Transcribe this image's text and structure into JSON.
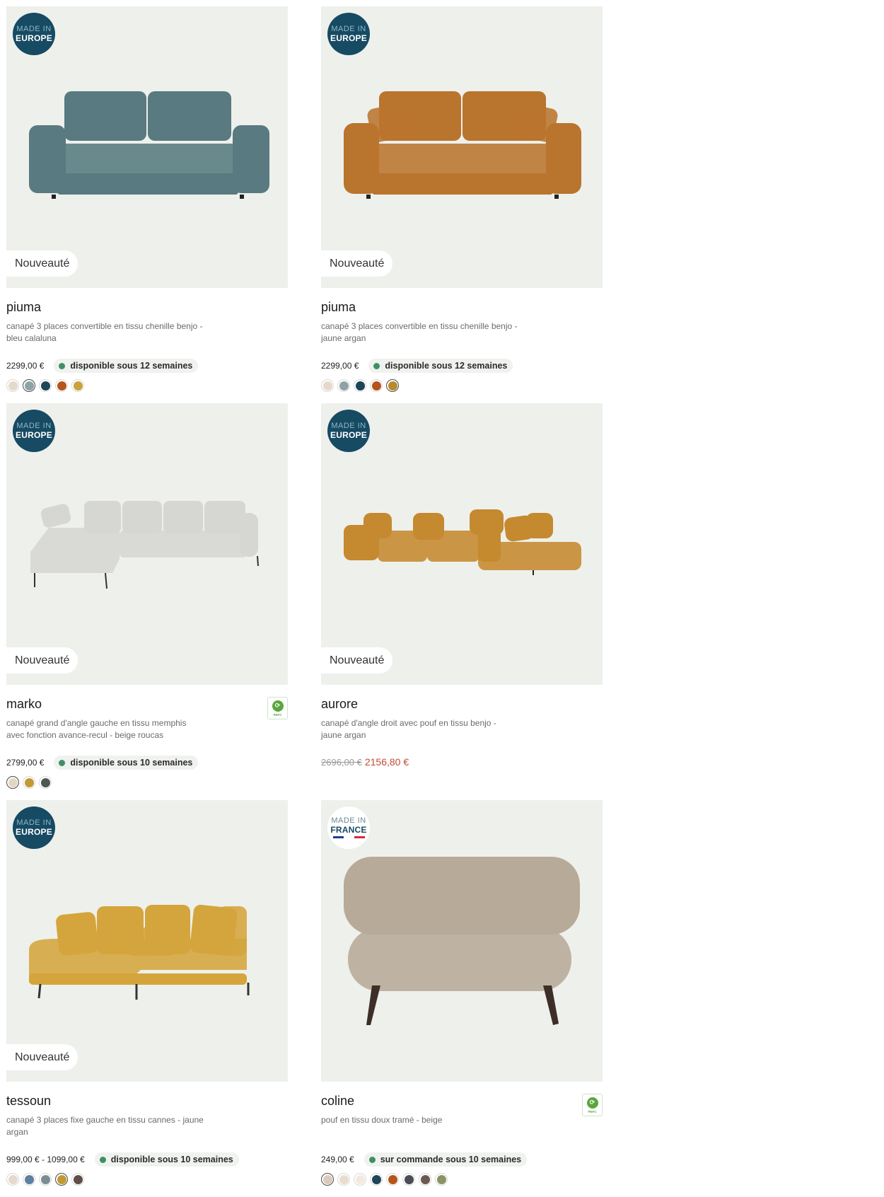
{
  "products": [
    {
      "origin": {
        "line1": "MADE IN",
        "line2": "EUROPE"
      },
      "tag": "Nouveauté",
      "name": "piuma",
      "description": "canapé 3 places convertible en tissu chenille benjo - bleu calaluna",
      "price": "2299,00 €",
      "availability": "disponible sous 12 semaines",
      "sofa_color": "#587a80",
      "swatches": [
        "#e6d9cc",
        "#8ea3a8",
        "#1f4559",
        "#b5541c",
        "#c9a23a"
      ]
    },
    {
      "origin": {
        "line1": "MADE IN",
        "line2": "EUROPE"
      },
      "tag": "Nouveauté",
      "name": "piuma",
      "description": "canapé 3 places convertible en tissu chenille benjo - jaune argan",
      "price": "2299,00 €",
      "availability": "disponible sous 12 semaines",
      "sofa_color": "#b9742d",
      "swatches": [
        "#e6d9cc",
        "#8ea3a8",
        "#1f4559",
        "#b5541c",
        "#b98a2a"
      ]
    },
    {
      "origin": {
        "line1": "MADE IN",
        "line2": "EUROPE"
      },
      "tag": "Nouveauté",
      "name": "marko",
      "description": "canapé grand d'angle gauche en tissu memphis avec fonction avance-recul - beige roucas",
      "price": "2799,00 €",
      "availability": "disponible sous 10 semaines",
      "certification": "PEFC",
      "sofa_color": "#d6d6d2",
      "swatches": [
        "#e3d7c4",
        "#c29a33",
        "#4f5650"
      ]
    },
    {
      "origin": {
        "line1": "MADE IN",
        "line2": "EUROPE"
      },
      "tag": "Nouveauté",
      "name": "aurore",
      "description": "canapé d'angle droit avec pouf en tissu benjo - jaune argan",
      "old_price": "2696,00 €",
      "sale_price": "2156,80 €",
      "sofa_color": "#c5892f",
      "swatches": []
    },
    {
      "origin": {
        "line1": "MADE IN",
        "line2": "EUROPE"
      },
      "tag": "Nouveauté",
      "name": "tessoun",
      "description": "canapé 3 places fixe gauche en tissu cannes - jaune argan",
      "price": "999,00 € - 1099,00 €",
      "availability": "disponible sous 10 semaines",
      "sofa_color": "#d4a53c",
      "swatches": [
        "#e6d9cc",
        "#5d7fa0",
        "#7c8c93",
        "#c29a33",
        "#5e5048"
      ]
    },
    {
      "origin": {
        "line1": "MADE IN",
        "line2": "FRANCE"
      },
      "name": "coline",
      "description": "pouf en tissu doux tramé - beige",
      "price": "249,00 €",
      "availability": "sur commande sous 10 semaines",
      "certification": "PEFC",
      "sofa_color": "#b7aa98",
      "swatches": [
        "#d9cabb",
        "#e9dccd",
        "#f3eadf",
        "#1f4559",
        "#b5541c",
        "#4a4d55",
        "#6b5a52",
        "#8d9166"
      ]
    }
  ]
}
